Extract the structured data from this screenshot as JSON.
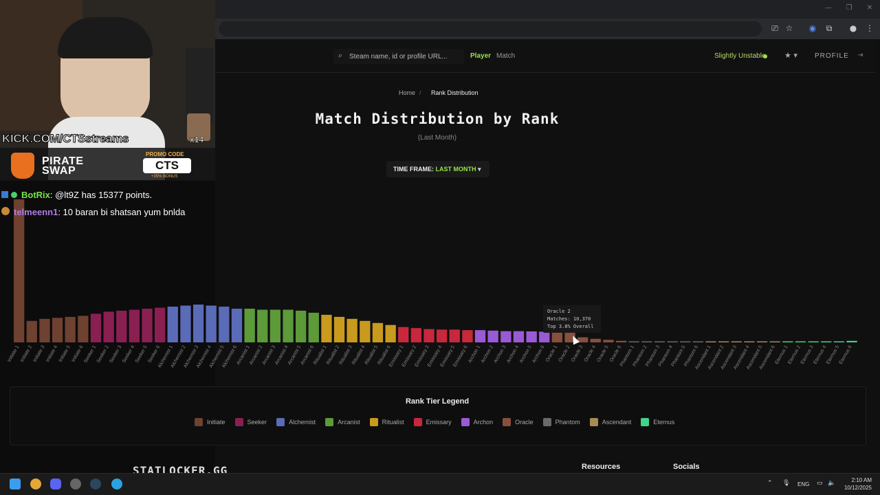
{
  "browser": {
    "tab_icons": [
      "cast-icon",
      "star-icon",
      "extension-icon",
      "puzzle-icon",
      "profile-icon",
      "menu-icon"
    ]
  },
  "nav": {
    "search_placeholder": "Steam name, id or profile URL...",
    "tab_player": "Player",
    "tab_match": "Match",
    "status": "Slightly Unstable",
    "profile": "PROFILE",
    "colors": {
      "active": "#9be34a",
      "inactive": "#9a9a9a"
    }
  },
  "breadcrumb": {
    "home": "Home",
    "sep": "/",
    "current": "Rank Distribution"
  },
  "page": {
    "title": "Match Distribution by Rank",
    "subtitle": "(Last Month)"
  },
  "timeframe": {
    "label": "TIME FRAME:",
    "value": "LAST MONTH",
    "caret": "▾"
  },
  "chart_data": {
    "type": "bar",
    "categories": [
      "Initiate 1",
      "Initiate 2",
      "Initiate 3",
      "Initiate 4",
      "Initiate 5",
      "Initiate 6",
      "Seeker 1",
      "Seeker 2",
      "Seeker 3",
      "Seeker 4",
      "Seeker 5",
      "Seeker 6",
      "Alchemist 1",
      "Alchemist 2",
      "Alchemist 3",
      "Alchemist 4",
      "Alchemist 5",
      "Alchemist 6",
      "Arcanist 1",
      "Arcanist 2",
      "Arcanist 3",
      "Arcanist 4",
      "Arcanist 5",
      "Arcanist 6",
      "Ritualist 1",
      "Ritualist 2",
      "Ritualist 3",
      "Ritualist 4",
      "Ritualist 5",
      "Ritualist 6",
      "Emissary 1",
      "Emissary 2",
      "Emissary 3",
      "Emissary 4",
      "Emissary 5",
      "Emissary 6",
      "Archon 1",
      "Archon 2",
      "Archon 3",
      "Archon 4",
      "Archon 5",
      "Archon 6",
      "Oracle 1",
      "Oracle 2",
      "Oracle 3",
      "Oracle 4",
      "Oracle 5",
      "Oracle 6",
      "Phantom 1",
      "Phantom 2",
      "Phantom 3",
      "Phantom 4",
      "Phantom 5",
      "Phantom 6",
      "Ascendant 1",
      "Ascendant 2",
      "Ascendant 3",
      "Ascendant 4",
      "Ascendant 5",
      "Ascendant 6",
      "Eternus 1",
      "Eternus 2",
      "Eternus 3",
      "Eternus 4",
      "Eternus 5",
      "Eternus 6"
    ],
    "values": [
      140000,
      21000,
      23000,
      24000,
      25000,
      26000,
      28000,
      30000,
      31000,
      32000,
      33000,
      34000,
      35000,
      36000,
      37000,
      36000,
      35000,
      33000,
      33000,
      32000,
      32000,
      32000,
      31000,
      29000,
      27000,
      25000,
      23000,
      21000,
      19000,
      17000,
      15000,
      14000,
      13000,
      12500,
      12500,
      12000,
      12000,
      11500,
      11000,
      11000,
      10800,
      10500,
      10200,
      10370,
      5000,
      3500,
      2500,
      1500,
      800,
      700,
      600,
      500,
      400,
      300,
      300,
      300,
      300,
      250,
      250,
      200,
      200,
      200,
      200,
      250,
      300,
      1500
    ],
    "tiers": [
      "Initiate",
      "Seeker",
      "Alchemist",
      "Arcanist",
      "Ritualist",
      "Emissary",
      "Archon",
      "Oracle",
      "Phantom",
      "Ascendant",
      "Eternus"
    ],
    "tier_colors": [
      "#6e4130",
      "#8a1f52",
      "#5a6bb8",
      "#5c9a3a",
      "#c99a1e",
      "#c8283c",
      "#9a5ad6",
      "#87503e",
      "#6a6a6a",
      "#a88a52",
      "#3fd48a"
    ],
    "ylim": [
      0,
      140000
    ],
    "grid": false
  },
  "tooltip": {
    "line1": "Oracle 2",
    "line2": "Matches: 10,370",
    "line3": "Top 3.8% Overall"
  },
  "legend": {
    "title": "Rank Tier Legend",
    "items": [
      "Initiate",
      "Seeker",
      "Alchemist",
      "Arcanist",
      "Ritualist",
      "Emissary",
      "Archon",
      "Oracle",
      "Phantom",
      "Ascendant",
      "Eternus"
    ]
  },
  "footer": {
    "brand": "STATLOCKER.GG",
    "resources": "Resources",
    "socials": "Socials"
  },
  "overlay": {
    "kick": "KICK.COM/CTSstreams",
    "pirate": "PIRATE\nSWAP",
    "promo_label": "PROMO CODE",
    "promo_code": "CTS",
    "promo_bonus": "+35% BONUS",
    "sub_badge": "x14"
  },
  "chat": [
    {
      "user": "BotRix",
      "color": "#7be34a",
      "text": ": @lt9Z has 15377 points."
    },
    {
      "user": "telmeenn1",
      "color": "#b07be8",
      "text": ": 10 baran bi shatsan yum bnlda"
    }
  ],
  "taskbar": {
    "lang": "ENG",
    "time": "2:10 AM",
    "date": "10/12/2025"
  }
}
